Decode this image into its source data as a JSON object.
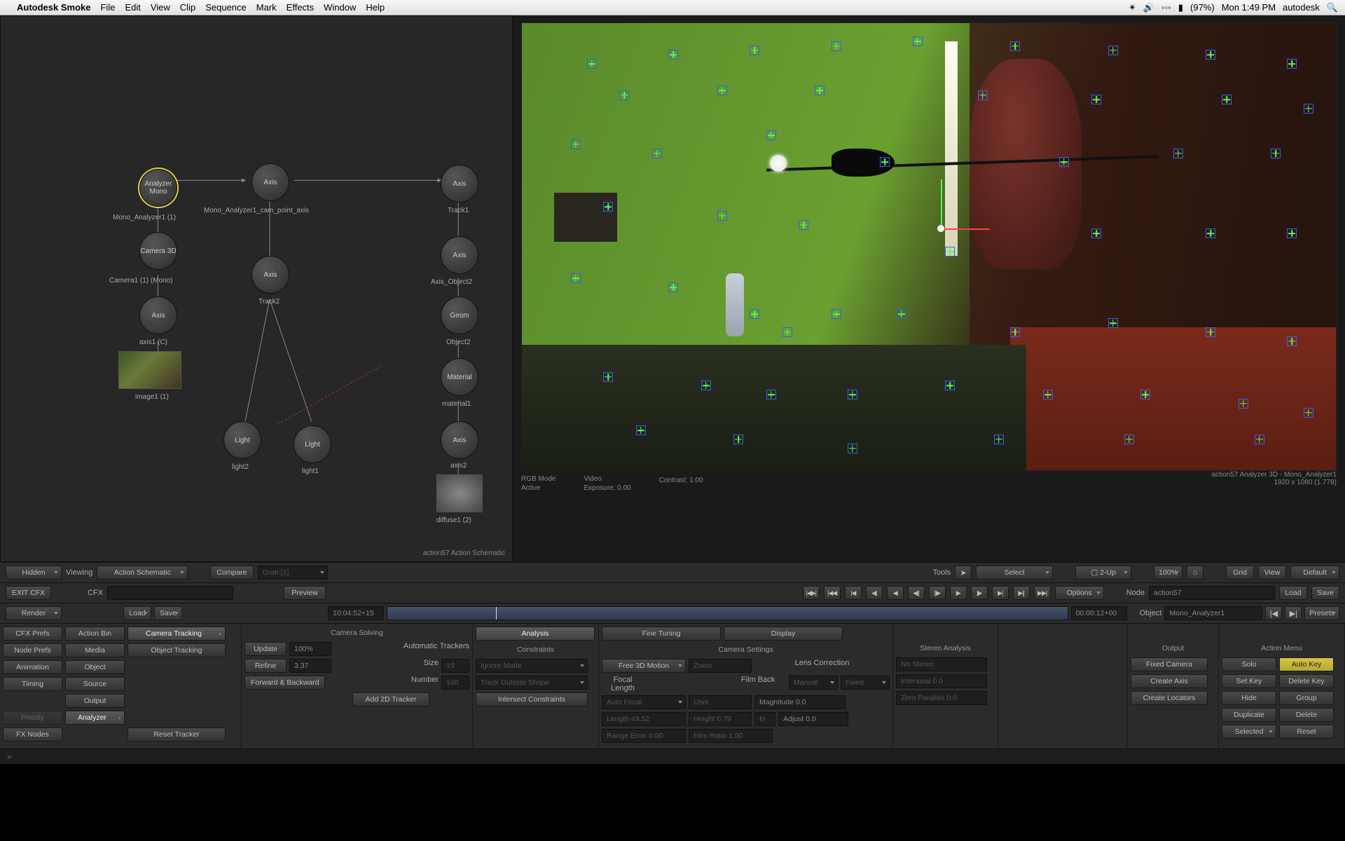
{
  "menubar": {
    "app": "Autodesk Smoke",
    "items": [
      "File",
      "Edit",
      "View",
      "Clip",
      "Sequence",
      "Mark",
      "Effects",
      "Window",
      "Help"
    ],
    "battery": "(97%)",
    "clock": "Mon 1:49 PM",
    "user": "autodesk"
  },
  "schematic": {
    "title": "action57 Action Schematic",
    "nodes": {
      "analyzer_mono": "Analyzer Mono",
      "analyzer_mono_label": "Mono_Analyzer1 (1)",
      "camera3d": "Camera 3D",
      "camera3d_label": "Camera1 (1) (Mono)",
      "axis_c": "Axis",
      "axis_c_label": "axis1 (C)",
      "image1_label": "image1 (1)",
      "axis_top": "Axis",
      "axis_top_label": "Mono_Analyzer1_cam_point_axis",
      "axis_mid": "Axis",
      "axis_mid_label": "Track2",
      "light1": "Light",
      "light1_label": "light1",
      "light2": "Light",
      "light2_label": "light2",
      "axis_r1": "Axis",
      "axis_r1_label": "Track1",
      "axis_r2": "Axis",
      "axis_r2_label": "Axis_Object2",
      "geom": "Geom",
      "geom_label": "Object2",
      "material": "Material",
      "material_label": "material1",
      "axis_r3": "Axis",
      "axis_r3_label": "axis2",
      "diffuse_label": "diffuse1 (2)"
    }
  },
  "viewport": {
    "rgb_mode": "RGB Mode",
    "active": "Active",
    "video": "Video",
    "exposure": "Exposure: 0.00",
    "contrast": "Contrast: 1.00",
    "topright_a": "action57 Analyzer 3D - Mono_Analyzer1",
    "topright_b": "1920 x 1080 (1.778)"
  },
  "toolbar1": {
    "hidden": "Hidden",
    "viewing": "Viewing",
    "action_schematic": "Action Schematic",
    "compare": "Compare",
    "grab": "Grab [1]",
    "tools": "Tools",
    "select": "Select",
    "two_up": "2-Up",
    "zoom": "100%",
    "grid": "Grid",
    "view": "View",
    "default": "Default"
  },
  "toolbar2": {
    "exit": "EXIT CFX",
    "cfx": "CFX",
    "preview": "Preview",
    "options": "Options",
    "node_lbl": "Node",
    "node_val": "action57",
    "load": "Load",
    "save": "Save"
  },
  "timeline": {
    "render": "Render",
    "load": "Load",
    "save": "Save",
    "tc_left": "10:04:52+15",
    "tc_right": "00:00:12+00",
    "object_lbl": "Object",
    "object_val": "Mono_Analyzer1",
    "presets": "Presets"
  },
  "sidebar": {
    "col1": [
      "CFX Prefs",
      "Node Prefs",
      "Animation",
      "Timing",
      "",
      "Priority",
      "FX Nodes"
    ],
    "col2": [
      "Action Bin",
      "Media",
      "Object",
      "Source",
      "Output",
      "Analyzer"
    ],
    "col3": [
      "Camera Tracking",
      "Object Tracking",
      "",
      "",
      "",
      "",
      "Reset Tracker"
    ]
  },
  "camera_solving": {
    "title": "Camera Solving",
    "update": "Update",
    "update_val": "100%",
    "refine": "Refine",
    "refine_val": "3.37",
    "fwdback": "Forward & Backward",
    "add2d": "Add 2D Tracker"
  },
  "auto_trackers": {
    "title": "Automatic Trackers",
    "size": "Size",
    "size_val": "19",
    "number": "Number",
    "number_val": "100"
  },
  "analysis_tabs": {
    "analysis": "Analysis",
    "fine": "Fine Tuning",
    "display": "Display"
  },
  "constraints": {
    "title": "Constraints",
    "ignore_matte": "Ignore Matte",
    "track_outside": "Track Outside Shape",
    "intersect": "Intersect Constraints"
  },
  "camera_settings": {
    "title": "Camera Settings",
    "free3d": "Free 3D Motion",
    "zoom": "Zoom",
    "focal": "Focal Length",
    "manual": "Manual",
    "fixed": "Fixed",
    "film_back": "Film Back",
    "auto_focal": "Auto Focal",
    "user": "User",
    "magnitude": "Magnitude 0.0",
    "length": "Length 49.52",
    "height": "Height 0.79",
    "in": "In",
    "adjust": "Adjust 0.0",
    "range_err": "Range Error 0.00",
    "film_ratio": "Film Ratio 1.00"
  },
  "lens": {
    "title": "Lens Correction",
    "interaxial": "Interaxial 0.0",
    "zero_parallax": "Zero Parallax 0.0"
  },
  "stereo": {
    "title": "Stereo Analysis",
    "no_stereo": "No Stereo"
  },
  "output": {
    "title": "Output",
    "fixed_camera": "Fixed Camera",
    "create_axis": "Create Axis",
    "create_locators": "Create Locators"
  },
  "action_menu": {
    "title": "Action Menu",
    "solo": "Solo",
    "auto_key": "Auto Key",
    "set_key": "Set Key",
    "delete_key": "Delete Key",
    "hide": "Hide",
    "group": "Group",
    "duplicate": "Duplicate",
    "delete": "Delete",
    "selected": "Selected",
    "reset": "Reset"
  }
}
